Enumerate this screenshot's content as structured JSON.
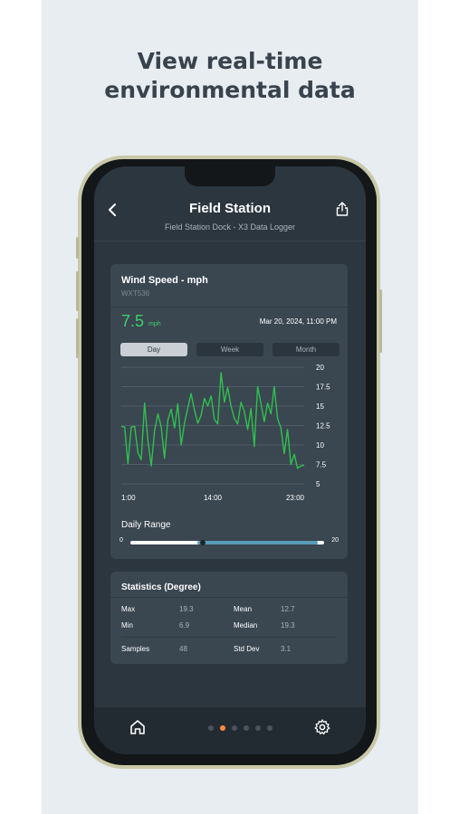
{
  "promo": {
    "line1": "View real-time",
    "line2": "environmental data"
  },
  "header": {
    "title": "Field Station",
    "subtitle": "Field Station Dock - X3 Data Logger",
    "back_icon": "chevron-left-icon",
    "share_icon": "share-icon"
  },
  "sensor_card": {
    "title": "Wind Speed - mph",
    "sensor_id": "WXT536",
    "current_value": "7.5",
    "unit": "mph",
    "timestamp": "Mar 20, 2024, 11:00 PM",
    "tabs": [
      {
        "label": "Day",
        "active": true
      },
      {
        "label": "Week",
        "active": false
      },
      {
        "label": "Month",
        "active": false
      }
    ],
    "daily_range": {
      "title": "Daily Range",
      "min_label": "0",
      "max_label": "20",
      "range_min": 0,
      "range_max": 20,
      "low": 6.9,
      "high": 19.3,
      "current": 7.5
    }
  },
  "chart_data": {
    "type": "line",
    "x_tick_labels": [
      "1:00",
      "14:00",
      "23:00"
    ],
    "y_tick_labels": [
      "20",
      "17.5",
      "15",
      "12.5",
      "10",
      "7.5",
      "5"
    ],
    "ylim": [
      5,
      20
    ],
    "grid": true,
    "line_color": "#2fc14f",
    "series": [
      {
        "values": [
          12.4,
          12.3,
          7.6,
          12.3,
          12.4,
          9.0,
          8.1,
          15.4,
          10.5,
          7.3,
          11.8,
          14.0,
          12.3,
          8.3,
          13.2,
          14.6,
          12.2,
          15.3,
          10.0,
          12.8,
          14.8,
          16.6,
          14.5,
          12.8,
          13.8,
          16.0,
          15.0,
          16.3,
          13.3,
          12.7,
          19.3,
          15.5,
          17.4,
          15.0,
          13.4,
          12.7,
          15.5,
          14.3,
          12.0,
          14.7,
          9.8,
          17.5,
          15.3,
          13.0,
          15.4,
          14.0,
          17.5,
          13.4,
          12.2,
          8.9,
          12.0,
          7.5,
          8.8,
          7.0,
          7.3,
          7.4
        ]
      }
    ]
  },
  "statistics": {
    "title": "Statistics (Degree)",
    "max_label": "Max",
    "max_value": "19.3",
    "min_label": "Min",
    "min_value": "6.9",
    "mean_label": "Mean",
    "mean_value": "12.7",
    "median_label": "Median",
    "median_value": "19.3",
    "samples_label": "Samples",
    "samples_value": "48",
    "stddev_label": "Std Dev",
    "stddev_value": "3.1"
  },
  "bottom_nav": {
    "home_icon": "home-icon",
    "settings_icon": "gear-icon",
    "page_count": 6,
    "active_page": 2
  },
  "colors": {
    "accent_green": "#3fd06a",
    "accent_orange": "#ff8a3d",
    "range_blue": "#5a9ab8"
  }
}
